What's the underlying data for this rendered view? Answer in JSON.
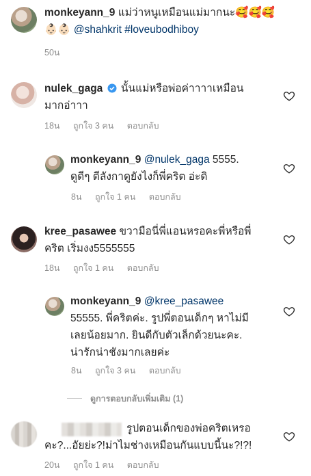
{
  "caption": {
    "username": "monkeyann_9",
    "text": "แม่ว่าหนูเหมือนแม่มากนะ🥰🥰🥰",
    "text2": "👶🏻👶🏻",
    "mention": "@shahkrit",
    "hashtag": "#loveubodhiboy",
    "time": "50น"
  },
  "comments": [
    {
      "username": "nulek_gaga",
      "verified": true,
      "line1": "นั้นแม่หรือพ่อค่าาาาเหมือน",
      "line2": "มากอ่าาา",
      "time": "18น",
      "likes": "ถูกใจ 3 คน",
      "reply": "ตอบกลับ"
    },
    {
      "username": "monkeyann_9",
      "mention": "@nulek_gaga",
      "line1_rest": "5555.",
      "line2": "ดูดีๆ ตีลังกาดูยังไงก็พี่คริต อ่ะดิ",
      "time": "8น",
      "likes": "ถูกใจ 1 คน",
      "reply": "ตอบกลับ"
    },
    {
      "username": "kree_pasawee",
      "line1": "ขวามือนี่พี่แอนหรอคะพี่หรือพี่",
      "line2": "คริต เริ่มงง5555555",
      "time": "18น",
      "likes": "ถูกใจ 1 คน",
      "reply": "ตอบกลับ"
    },
    {
      "username": "monkeyann_9",
      "mention": "@kree_pasawee",
      "line2": "55555. พี่คริตค่ะ. รูปพี่ตอนเด็กๆ หาไม่มี",
      "line3": "เลยน้อยมาก.  ยินดีกับตัวเล็กด้วยนะคะ.",
      "line4": "น่ารักน่าชังมากเลยค่ะ",
      "time": "8น",
      "likes": "ถูกใจ 3 คน",
      "reply": "ตอบกลับ"
    },
    {
      "view_more": "ดูการตอบกลับเพิ่มเติม (1)"
    },
    {
      "line1": "รูปตอนเด็กของพ่อคริตเหรอ",
      "line2": "คะ?...อัยย่ะ?!ม่าไมช่างเหมือนกันแบบนี้นะ?!?!",
      "time": "20น",
      "likes": "ถูกใจ 1 คน",
      "reply": "ตอบกลับ"
    }
  ]
}
